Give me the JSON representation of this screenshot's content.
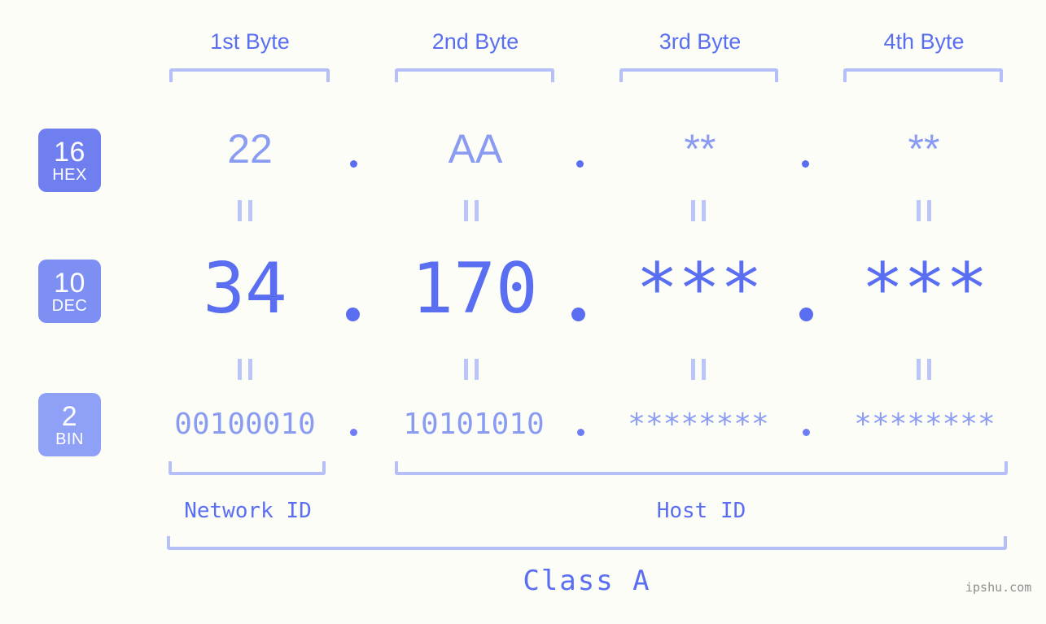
{
  "page": {
    "background_color": "#fcfdf7",
    "accent_color": "#5a6ef2",
    "accent_light_color": "#8a9bf2",
    "bracket_color": "#b6c0f8"
  },
  "byte_headers": [
    {
      "label": "1st Byte"
    },
    {
      "label": "2nd Byte"
    },
    {
      "label": "3rd Byte"
    },
    {
      "label": "4th Byte"
    }
  ],
  "rows": [
    {
      "badge": {
        "number": "16",
        "name": "HEX",
        "color": "#707ff0"
      },
      "values": [
        "22",
        "AA",
        "**",
        "**"
      ],
      "separator": "."
    },
    {
      "badge": {
        "number": "10",
        "name": "DEC",
        "color": "#7e8ff4"
      },
      "values": [
        "34",
        "170",
        "***",
        "***"
      ],
      "separator": "."
    },
    {
      "badge": {
        "number": "2",
        "name": "BIN",
        "color": "#8fa0f7"
      },
      "values": [
        "00100010",
        "10101010",
        "********",
        "********"
      ],
      "separator": "."
    }
  ],
  "equivalence_mark": "||",
  "segments": [
    {
      "label": "Network ID"
    },
    {
      "label": "Host ID"
    }
  ],
  "class": {
    "label": "Class A"
  },
  "watermark": {
    "text": "ipshu.com"
  }
}
